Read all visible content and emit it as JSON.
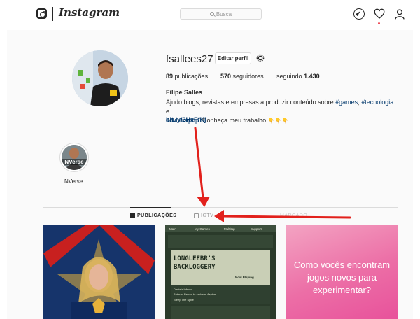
{
  "header": {
    "app_name": "Instagram",
    "search_placeholder": "Busca",
    "icons": [
      "instagram-glyph-icon",
      "search-icon",
      "compass-icon",
      "heart-icon",
      "person-icon"
    ]
  },
  "profile": {
    "username": "fsallees27",
    "edit_label": "Editar perfil",
    "posts_count": "89",
    "posts_label": "publicações",
    "followers_count": "570",
    "followers_label": "seguidores",
    "following_label": "seguindo",
    "following_count": "1.430",
    "full_name": "Filipe Salles",
    "bio_line1_a": "Ajudo blogs, revistas e empresas a produzir conteúdo sobre ",
    "bio_tag_games": "#games",
    "bio_sep1": ", ",
    "bio_tag_tech": "#tecnologia",
    "bio_line1_end": " e",
    "bio_tag_culture": "#culturapop",
    "bio_line2_b": ". Conheça meu trabalho ",
    "bio_emoji": "👇👇👇",
    "link": "bit.ly/2HxFfKj"
  },
  "highlights": [
    {
      "label": "NVerse",
      "cover_text": "NVerse"
    }
  ],
  "tabs": [
    {
      "label": "PUBLICAÇÕES",
      "active": true
    },
    {
      "label": "IGTV",
      "active": false
    },
    {
      "label": "MARCADO",
      "active": false
    }
  ],
  "posts": [
    {
      "kind": "image"
    },
    {
      "kind": "image",
      "nav": [
        "Main",
        "My Games",
        "Multitap",
        "Support"
      ],
      "title_line1": "LONGLEEBR'S",
      "title_line2": "BACKLOGGERY",
      "section": "Now Playing",
      "items": [
        "Dante's Inferno",
        "Batman Return to Arkham: Asylum",
        "Steep The Spire"
      ]
    },
    {
      "kind": "text",
      "text": "Como vocês encontram jogos novos para experimentar?"
    }
  ],
  "colors": {
    "link": "#00376b",
    "annotation_arrow": "#e2211c",
    "notification_dot": "#ed4956",
    "post3_bg": "#ec6ea6"
  }
}
